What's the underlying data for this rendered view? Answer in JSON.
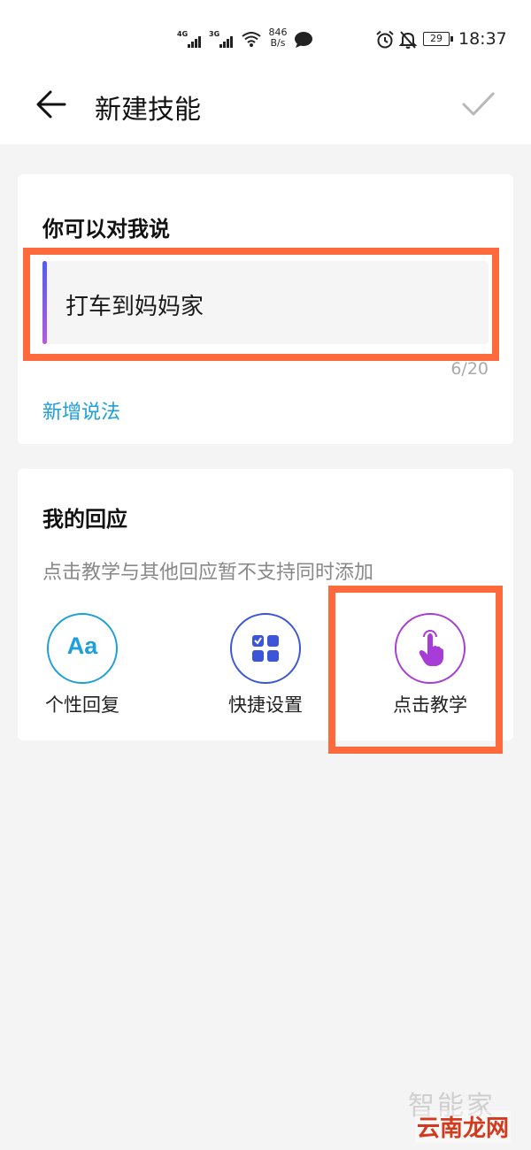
{
  "status_bar": {
    "net1": "4G",
    "net2": "3G",
    "speed_value": "846",
    "speed_unit": "B/s",
    "battery": "29",
    "time": "18:37"
  },
  "header": {
    "title": "新建技能",
    "back_icon": "arrow-left-icon",
    "confirm_icon": "check-icon"
  },
  "utterance_card": {
    "heading": "你可以对我说",
    "input_value": "打车到妈妈家",
    "counter": "6/20",
    "add_link": "新增说法"
  },
  "response_card": {
    "heading": "我的回应",
    "hint": "点击教学与其他回应暂不支持同时添加",
    "options": [
      {
        "label": "个性回复",
        "icon": "aa-text-icon",
        "icon_text": "Aa",
        "color": "#1e9fdb"
      },
      {
        "label": "快捷设置",
        "icon": "grid-check-icon",
        "color": "#3b56d6"
      },
      {
        "label": "点击教学",
        "icon": "tap-hand-icon",
        "color": "#a83cd6"
      }
    ]
  },
  "colors": {
    "accent_blue": "#1e9fdb",
    "highlight": "#ff6a3d",
    "background": "#f4f4f4"
  },
  "watermark": {
    "top_text": "智能家",
    "bottom_text": "云南龙网"
  }
}
